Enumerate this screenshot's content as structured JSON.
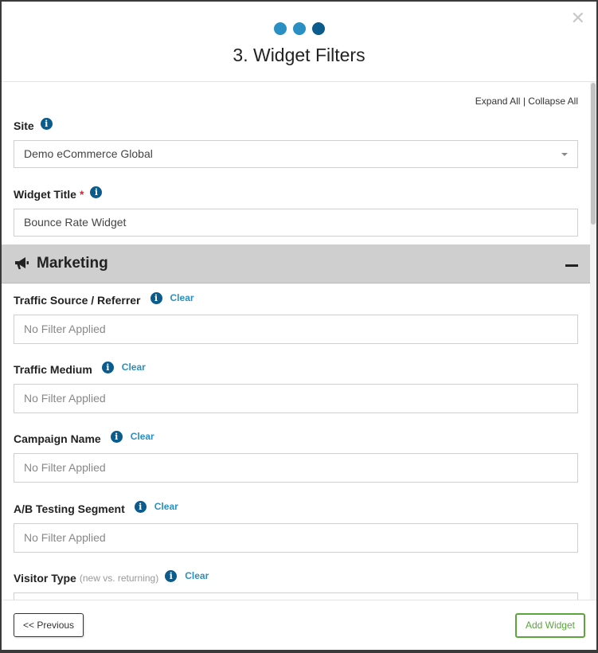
{
  "modal": {
    "title": "3. Widget Filters",
    "close_glyph": "✕",
    "steps": [
      {
        "color": "#2a8fc3"
      },
      {
        "color": "#2a8fc3"
      },
      {
        "color": "#0b5b8c"
      }
    ]
  },
  "toolbar": {
    "expand_all": "Expand All",
    "separator": "|",
    "collapse_all": "Collapse All"
  },
  "site": {
    "label": "Site",
    "value": "Demo eCommerce Global"
  },
  "widget_title": {
    "label": "Widget Title",
    "required_mark": "*",
    "value": "Bounce Rate Widget"
  },
  "section": {
    "title": "Marketing",
    "icon": "megaphone-icon",
    "state": "expanded"
  },
  "filters": [
    {
      "label": "Traffic Source / Referrer",
      "sub": "",
      "clear": "Clear",
      "placeholder": "No Filter Applied"
    },
    {
      "label": "Traffic Medium",
      "sub": "",
      "clear": "Clear",
      "placeholder": "No Filter Applied"
    },
    {
      "label": "Campaign Name",
      "sub": "",
      "clear": "Clear",
      "placeholder": "No Filter Applied"
    },
    {
      "label": "A/B Testing Segment",
      "sub": "",
      "clear": "Clear",
      "placeholder": "No Filter Applied"
    },
    {
      "label": "Visitor Type",
      "sub": "(new vs. returning)",
      "clear": "Clear",
      "placeholder": ""
    }
  ],
  "info_glyph": "i",
  "footer": {
    "previous_label": "<< Previous",
    "add_label": "Add Widget"
  },
  "colors": {
    "accent": "#2a8fc3",
    "info": "#0b5b8c",
    "add_button": "#5aa63c",
    "section_bg": "#cfcfcf"
  }
}
